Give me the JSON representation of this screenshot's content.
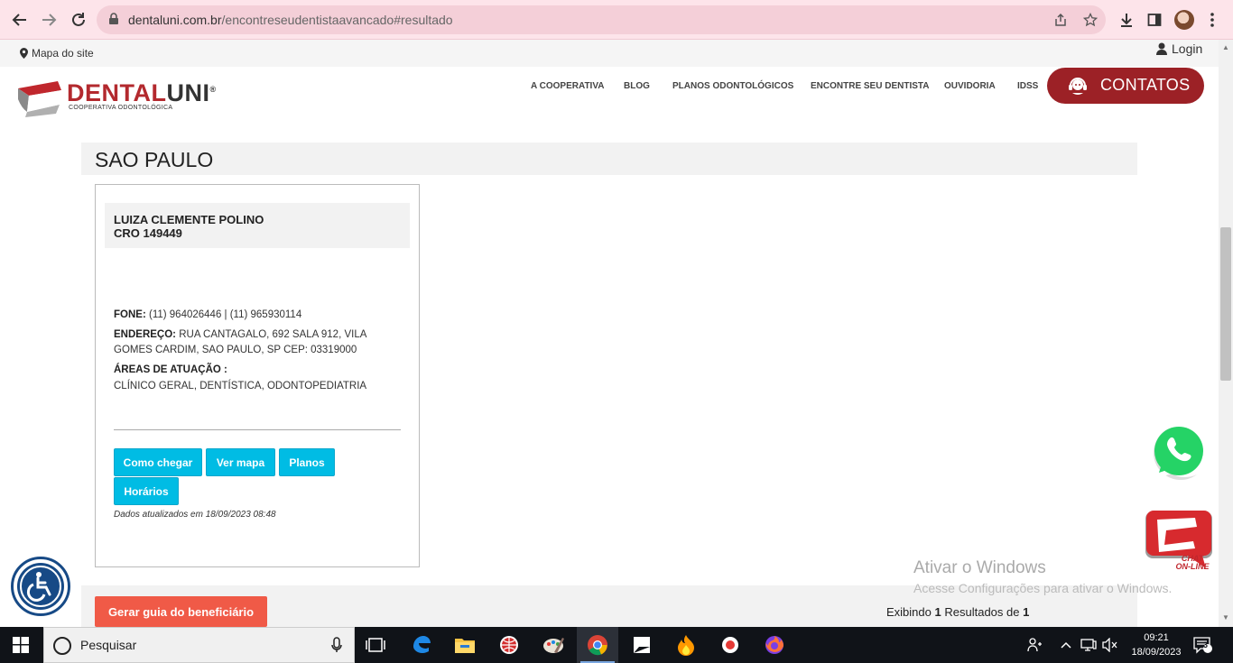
{
  "browser": {
    "url_domain": "dentaluni.com.br",
    "url_path": "/encontreseudentistaavancado#resultado"
  },
  "topbar": {
    "site_map": "Mapa do site",
    "login": "Login"
  },
  "logo": {
    "word_a": "DENTAL",
    "word_b": "UNI",
    "registered": "®",
    "subtitle": "COOPERATIVA ODONTOLÓGICA"
  },
  "nav": {
    "items": [
      "A COOPERATIVA",
      "BLOG",
      "PLANOS ODONTOLÓGICOS",
      "ENCONTRE SEU DENTISTA",
      "OUVIDORIA",
      "IDSS"
    ],
    "contact": "CONTATOS"
  },
  "region": {
    "title": "SAO PAULO"
  },
  "dentist": {
    "name": "LUIZA CLEMENTE POLINO",
    "cro": "CRO 149449",
    "phone_label": "FONE:",
    "phone": "(11) 964026446 | (11) 965930114",
    "address_label": "ENDEREÇO:",
    "address": "RUA CANTAGALO, 692 SALA 912, VILA GOMES CARDIM, SAO PAULO, SP CEP: 03319000",
    "areas_label": "ÁREAS DE ATUAÇÃO :",
    "areas": "CLÍNICO GERAL, DENTÍSTICA, ODONTOPEDIATRIA",
    "buttons": [
      "Como chegar",
      "Ver mapa",
      "Planos",
      "Horários"
    ],
    "updated": "Dados atualizados em 18/09/2023 08:48"
  },
  "footer": {
    "guide_button": "Gerar guia do beneficiário",
    "results_prefix": "Exibindo",
    "results_shown": "1",
    "results_mid": "Resultados de",
    "results_total": "1"
  },
  "watermark": {
    "line1": "Ativar o Windows",
    "line2": "Acesse Configurações para ativar o Windows."
  },
  "chat_widget": {
    "line1": "CHAT",
    "line2": "ON-LINE"
  },
  "taskbar": {
    "search_placeholder": "Pesquisar",
    "time": "09:21",
    "date": "18/09/2023",
    "notifications": "3"
  },
  "colors": {
    "brand_red": "#9c2126",
    "button_cyan": "#00bce4",
    "guide_orange": "#f05a47",
    "whatsapp_green": "#25d366"
  }
}
